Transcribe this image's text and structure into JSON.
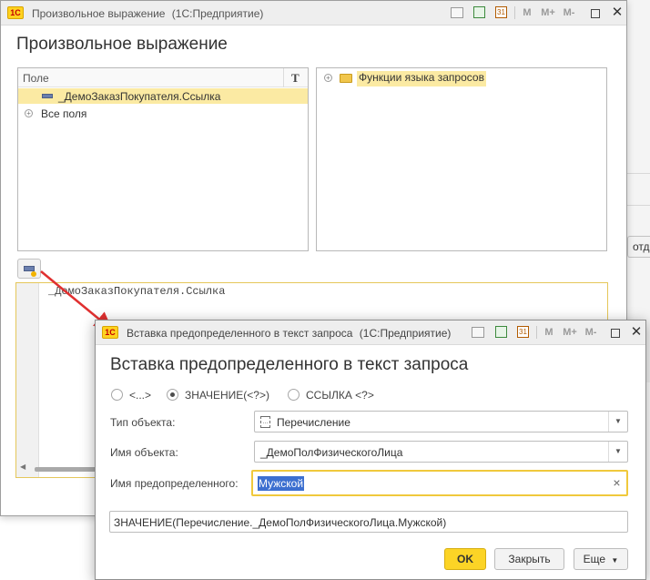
{
  "background_window": {
    "title": "Произвольное выражение",
    "title_suffix": "(1С:Предприятие)",
    "titlebar_buttons": [
      "M",
      "M+",
      "M-"
    ],
    "header": "Произвольное выражение",
    "fields_panel": {
      "column_header": "Поле",
      "type_column_header": "T",
      "rows": [
        {
          "label": "_ДемоЗаказПокупателя.Ссылка",
          "selected": true
        },
        {
          "label": "Все поля",
          "selected": false
        }
      ]
    },
    "functions_panel": {
      "rows": [
        {
          "label": "Функции языка запросов",
          "selected": true
        }
      ]
    },
    "editor_text": "_ДемоЗаказПокупателя.Ссылка"
  },
  "side_window": {
    "button_label": "отд"
  },
  "dialog": {
    "title": "Вставка предопределенного в текст запроса",
    "title_suffix": "(1С:Предприятие)",
    "titlebar_buttons": [
      "M",
      "M+",
      "M-"
    ],
    "header": "Вставка предопределенного в текст запроса",
    "radio_options": [
      {
        "label": "<...>",
        "checked": false
      },
      {
        "label": "ЗНАЧЕНИЕ(<?>)",
        "checked": true
      },
      {
        "label": "ССЫЛКА <?>",
        "checked": false
      }
    ],
    "object_type": {
      "label": "Тип объекта:",
      "value": "Перечисление"
    },
    "object_name": {
      "label": "Имя объекта:",
      "value": "_ДемоПолФизическогоЛица"
    },
    "predefined_name": {
      "label": "Имя предопределенного:",
      "value": "Мужской"
    },
    "result_expression": "ЗНАЧЕНИЕ(Перечисление._ДемоПолФизическогоЛица.Мужской)",
    "buttons": {
      "ok": "OK",
      "close": "Закрыть",
      "more": "Еще"
    }
  },
  "colors": {
    "accent_yellow": "#fcd426",
    "selection_highlight": "#fbeaa3",
    "text_selection": "#3c6fd0",
    "arrow_red": "#e03030"
  }
}
